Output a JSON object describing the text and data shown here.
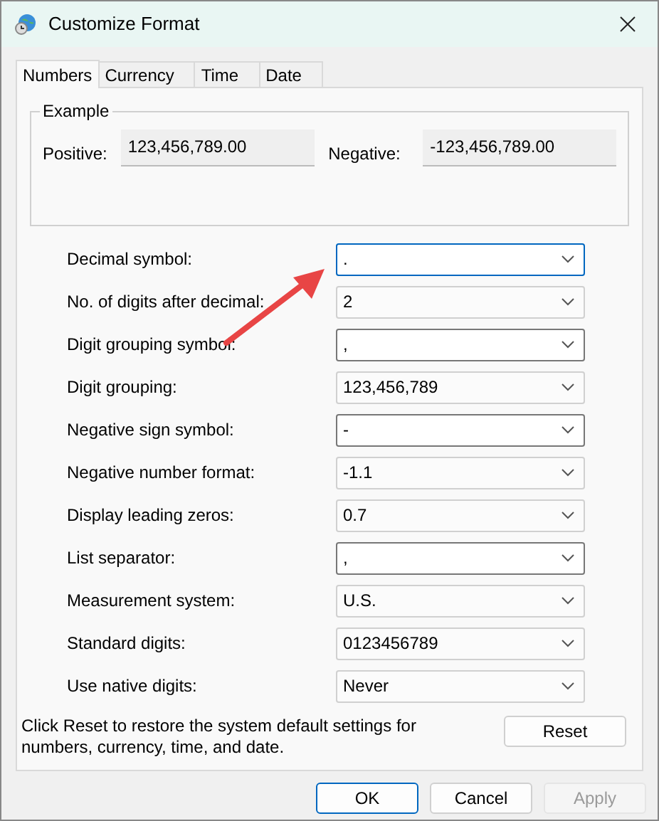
{
  "window": {
    "title": "Customize Format"
  },
  "tabs": [
    {
      "label": "Numbers",
      "selected": true
    },
    {
      "label": "Currency",
      "selected": false
    },
    {
      "label": "Time",
      "selected": false
    },
    {
      "label": "Date",
      "selected": false
    }
  ],
  "example": {
    "title": "Example",
    "positive_label": "Positive:",
    "positive_value": "123,456,789.00",
    "negative_label": "Negative:",
    "negative_value": "-123,456,789.00"
  },
  "settings": [
    {
      "label": "Decimal symbol:",
      "value": ".",
      "kind": "editable",
      "focused": true
    },
    {
      "label": "No. of digits after decimal:",
      "value": "2",
      "kind": "list",
      "focused": false
    },
    {
      "label": "Digit grouping symbol:",
      "value": ",",
      "kind": "editable",
      "focused": false
    },
    {
      "label": "Digit grouping:",
      "value": "123,456,789",
      "kind": "list",
      "focused": false
    },
    {
      "label": "Negative sign symbol:",
      "value": "-",
      "kind": "editable",
      "focused": false
    },
    {
      "label": "Negative number format:",
      "value": "-1.1",
      "kind": "list",
      "focused": false
    },
    {
      "label": "Display leading zeros:",
      "value": "0.7",
      "kind": "list",
      "focused": false
    },
    {
      "label": "List separator:",
      "value": ",",
      "kind": "editable",
      "focused": false
    },
    {
      "label": "Measurement system:",
      "value": "U.S.",
      "kind": "list",
      "focused": false
    },
    {
      "label": "Standard digits:",
      "value": "0123456789",
      "kind": "list",
      "focused": false
    },
    {
      "label": "Use native digits:",
      "value": "Never",
      "kind": "list",
      "focused": false
    }
  ],
  "reset_note": "Click Reset to restore the system default settings for numbers, currency, time, and date.",
  "reset_button": "Reset",
  "buttons": [
    {
      "label": "OK",
      "default": true,
      "disabled": false
    },
    {
      "label": "Cancel",
      "default": false,
      "disabled": false
    },
    {
      "label": "Apply",
      "default": false,
      "disabled": true
    }
  ]
}
